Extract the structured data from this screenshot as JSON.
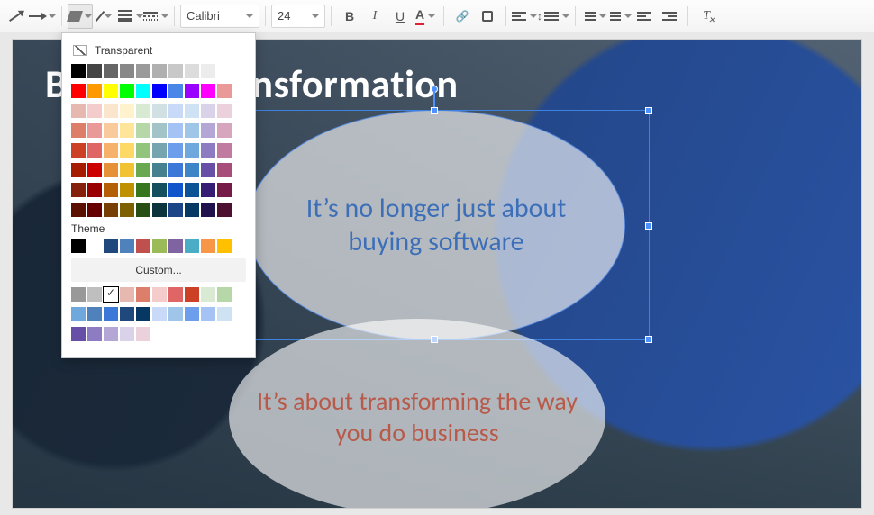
{
  "toolbar": {
    "font_name": "Calibri",
    "font_size": "24",
    "bold": "B",
    "italic": "I",
    "underline": "U",
    "textcolor": "A"
  },
  "picker": {
    "transparent_label": "Transparent",
    "theme_label": "Theme",
    "custom_label": "Custom...",
    "gray_row": [
      "#000000",
      "#444444",
      "#666666",
      "#888888",
      "#9a9a9a",
      "#b0b0b0",
      "#c8c8c8",
      "#dcdcdc",
      "#ececec",
      "#ffffff"
    ],
    "primary_row": [
      "#cc0000",
      "#e69138",
      "#f1c232",
      "#6aa84f",
      "#45818e",
      "#3d85c6",
      "#674ea7",
      "#a64d79",
      "#990000",
      "#ff00ff"
    ],
    "primary_row2": [
      "#ff0000",
      "#ff9900",
      "#ffff00",
      "#00ff00",
      "#00ffff",
      "#0000ff",
      "#4a86e8",
      "#9900ff",
      "#ff00ff",
      "#ea9999"
    ],
    "shade_grid": [
      [
        "#e6b8af",
        "#f4cccc",
        "#fce5cd",
        "#fff2cc",
        "#d9ead3",
        "#d0e0e3",
        "#c9daf8",
        "#cfe2f3",
        "#d9d2e9",
        "#ead1dc"
      ],
      [
        "#dd7e6b",
        "#ea9999",
        "#f9cb9c",
        "#ffe599",
        "#b6d7a8",
        "#a2c4c9",
        "#a4c2f4",
        "#9fc5e8",
        "#b4a7d6",
        "#d5a6bd"
      ],
      [
        "#cc4125",
        "#e06666",
        "#f6b26b",
        "#ffd966",
        "#93c47d",
        "#76a5af",
        "#6d9eeb",
        "#6fa8dc",
        "#8e7cc3",
        "#c27ba0"
      ],
      [
        "#a61c00",
        "#cc0000",
        "#e69138",
        "#f1c232",
        "#6aa84f",
        "#45818e",
        "#3c78d8",
        "#3d85c6",
        "#674ea7",
        "#a64d79"
      ],
      [
        "#85200c",
        "#990000",
        "#b45f06",
        "#bf9000",
        "#38761d",
        "#134f5c",
        "#1155cc",
        "#0b5394",
        "#351c75",
        "#741b47"
      ],
      [
        "#5b0f00",
        "#660000",
        "#783f04",
        "#7f6000",
        "#274e13",
        "#0c343d",
        "#1c4587",
        "#073763",
        "#20124d",
        "#4c1130"
      ]
    ],
    "theme_row": [
      "#000000",
      "#ffffff",
      "#1f497d",
      "#4f81bd",
      "#c0504d",
      "#9bbb59",
      "#8064a2",
      "#4bacc6",
      "#f79646",
      "#ffc000"
    ],
    "custom_grid": [
      [
        "#999999",
        "#bfbfbf",
        "#ffffff",
        "#e6b8af",
        "#dd7e6b",
        "#f4cccc",
        "#e06666",
        "#cc4125",
        "#d9ead3",
        "#b6d7a8"
      ],
      [
        "#6fa8dc",
        "#4f81bd",
        "#3c78d8",
        "#1f497d",
        "#073763",
        "#c9daf8",
        "#9fc5e8",
        "#6d9eeb",
        "#a4c2f4",
        "#cfe2f3"
      ],
      [
        "#674ea7",
        "#8e7cc3",
        "#b4a7d6",
        "#d9d2e9",
        "#ead1dc",
        "#ffffff",
        "#ffffff",
        "#ffffff",
        "#ffffff",
        "#ffffff"
      ]
    ]
  },
  "slide": {
    "title": "Business Transformation",
    "circle1_text": "It’s no longer just about buying software",
    "circle2_text": "It’s about transforming the way you do business"
  }
}
